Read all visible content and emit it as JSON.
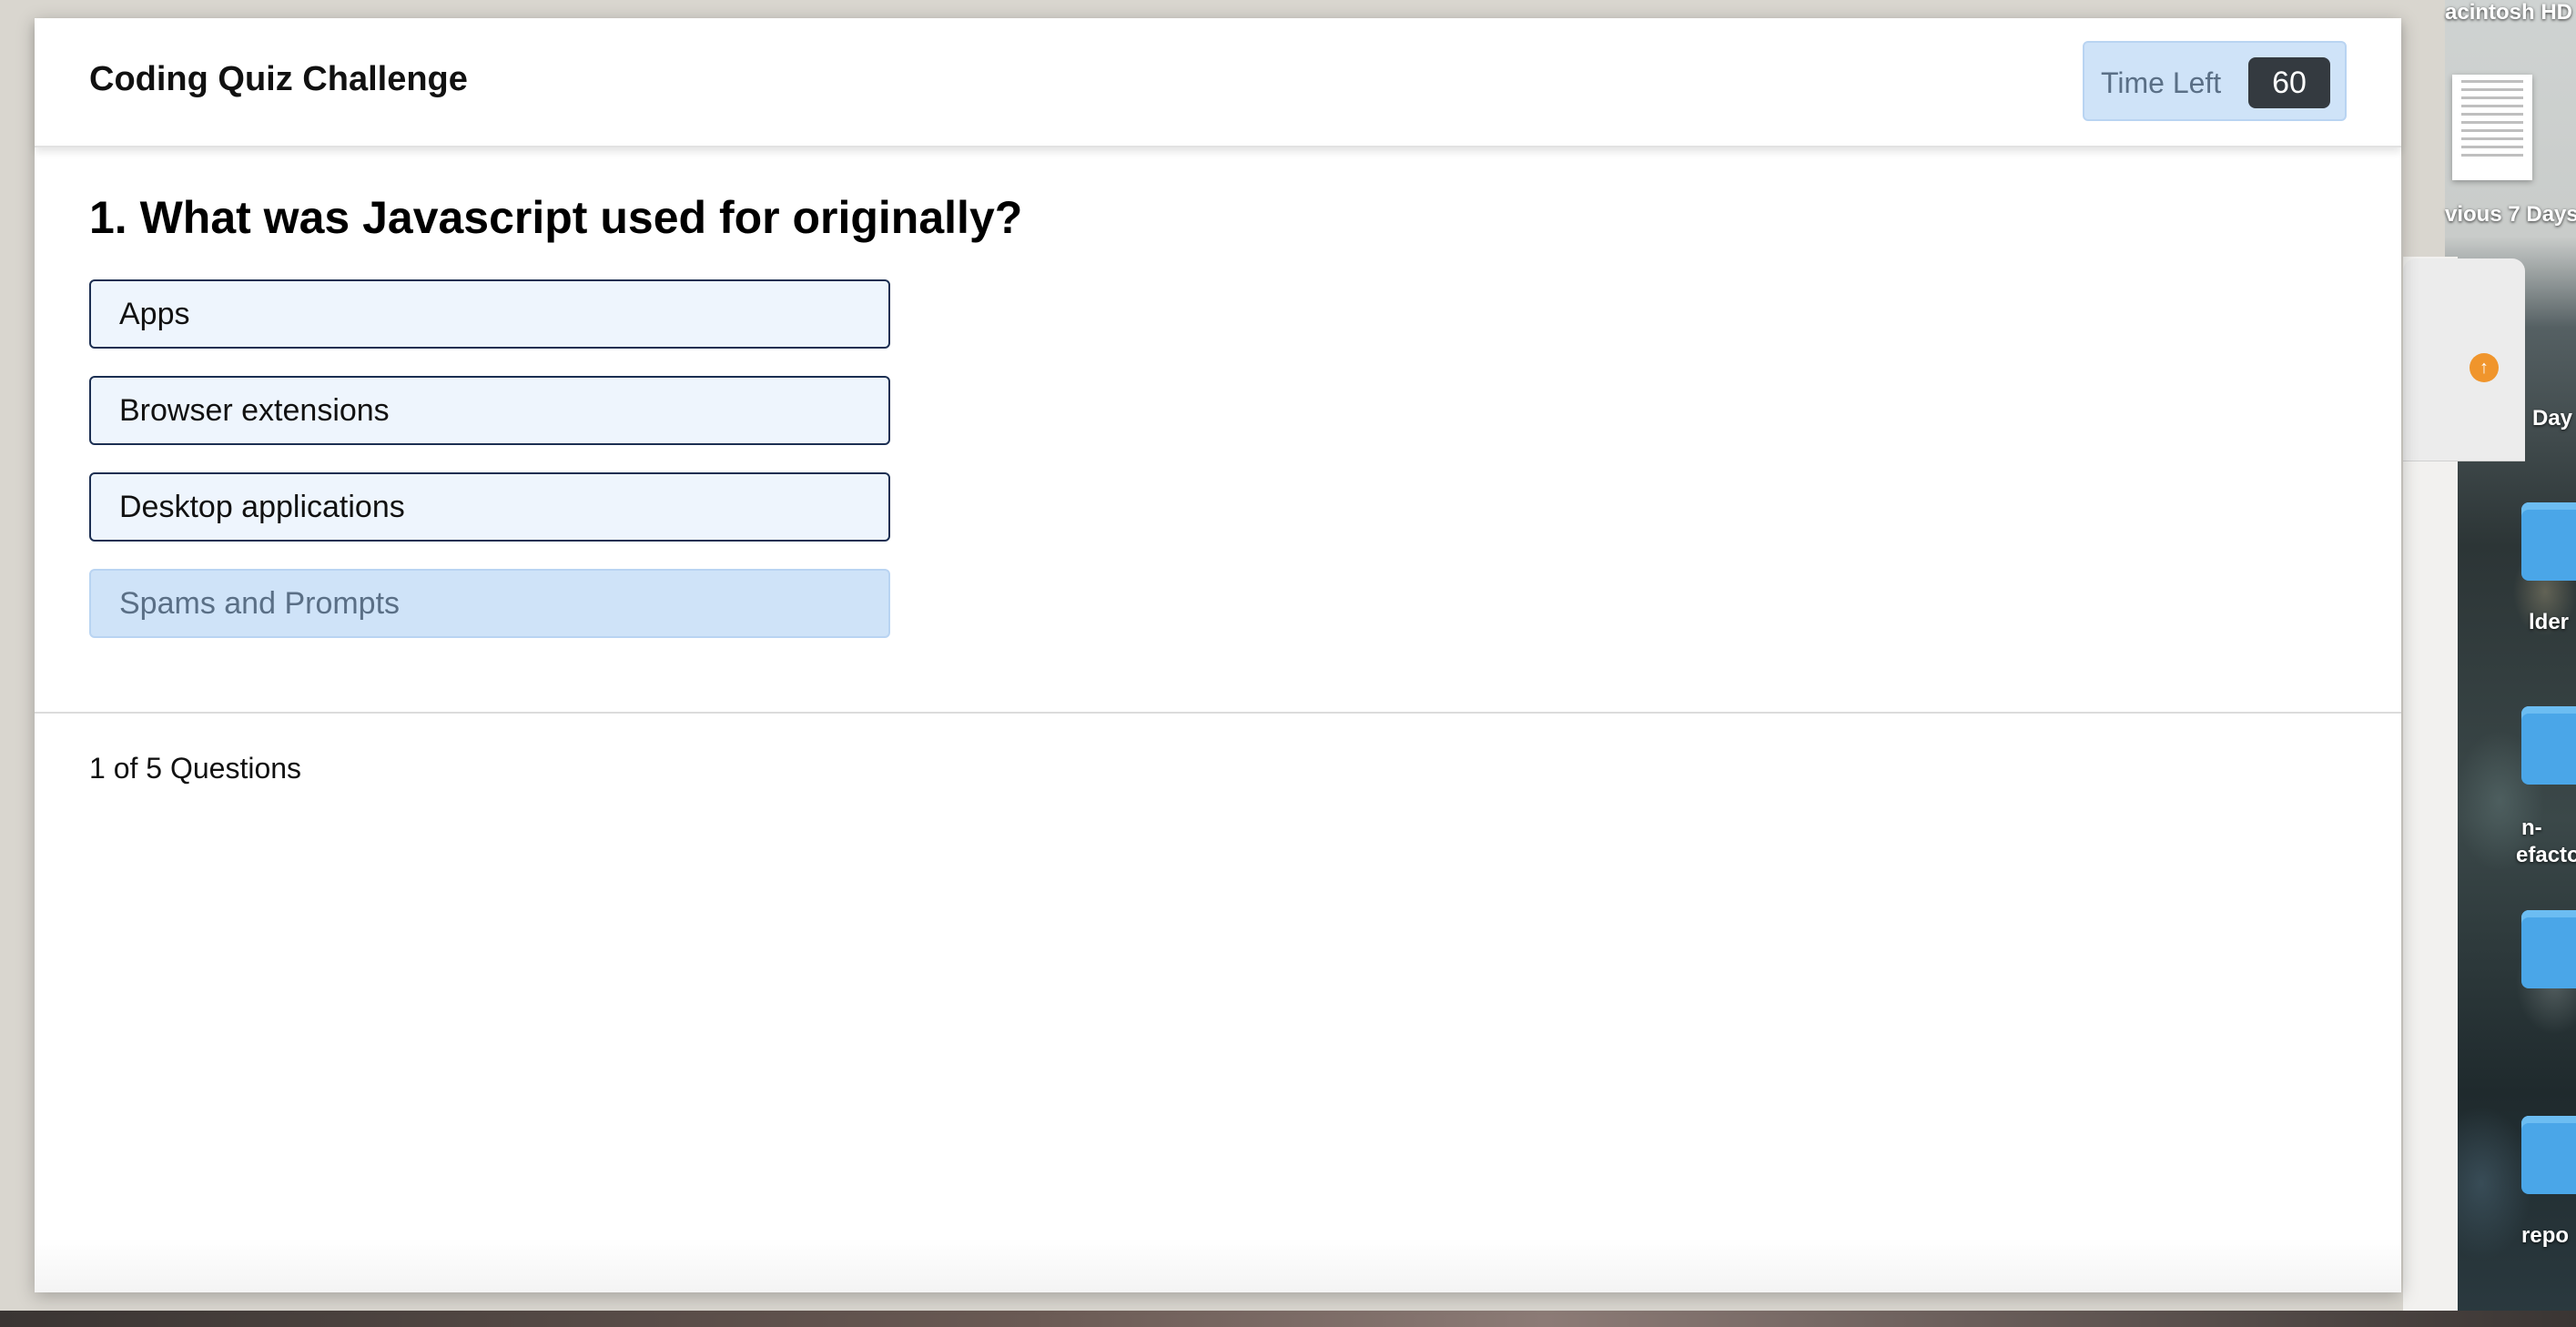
{
  "quiz": {
    "title": "Coding Quiz Challenge",
    "timer_label": "Time Left",
    "timer_value": "60",
    "question": "1. What was Javascript used for originally?",
    "choices": [
      "Apps",
      "Browser extensions",
      "Desktop applications",
      "Spams and Prompts"
    ],
    "progress": "1 of 5 Questions"
  },
  "desktop": {
    "drive_label": "acintosh HD",
    "recents_label": "vious 7 Days",
    "finder_label": "Day",
    "folder_labels": [
      "lder",
      "n-",
      "efacto",
      "repo"
    ]
  },
  "colors": {
    "accent_bg": "#cfe3f8",
    "choice_border": "#1c2f52",
    "timer_badge": "#343a40"
  }
}
